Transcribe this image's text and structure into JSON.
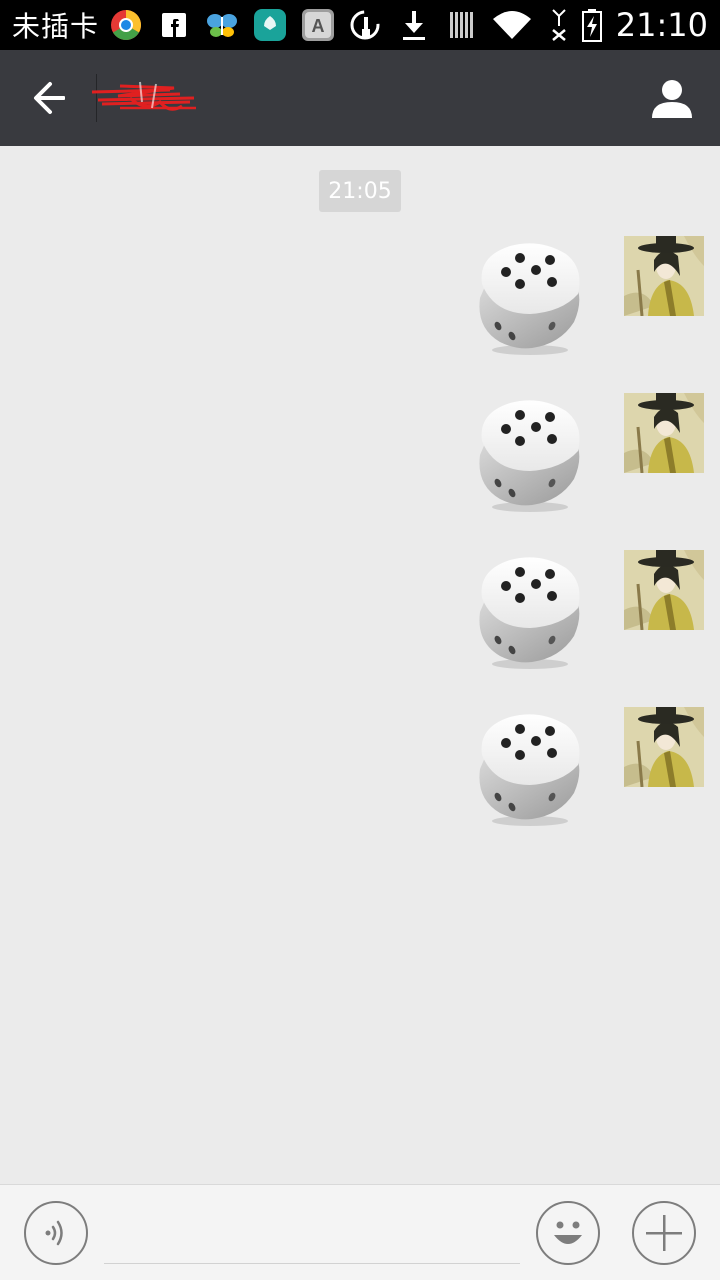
{
  "status_bar": {
    "carrier": "未插卡",
    "time": "21:10",
    "left_icons": [
      "chrome-icon",
      "facebook-icon",
      "butterfly-wifi-icon",
      "huawei-icon",
      "app-a-icon",
      "clock-clean-icon",
      "download-icon",
      "barcode-icon"
    ],
    "right_icons": [
      "wifi-icon",
      "no-signal-icon",
      "battery-charging-icon"
    ]
  },
  "title_bar": {
    "title": "",
    "back_icon": "arrow-left-icon",
    "profile_icon": "person-icon",
    "background": "#393a3f"
  },
  "chat": {
    "timestamp": "21:05",
    "messages": [
      {
        "type": "dice",
        "face": 5,
        "sender": "self"
      },
      {
        "type": "dice",
        "face": 5,
        "sender": "self"
      },
      {
        "type": "dice",
        "face": 5,
        "sender": "self"
      },
      {
        "type": "dice",
        "face": 5,
        "sender": "self"
      }
    ]
  },
  "input_bar": {
    "voice_icon": "voice-icon",
    "emoji_icon": "emoji-icon",
    "plus_icon": "plus-icon",
    "placeholder": ""
  }
}
